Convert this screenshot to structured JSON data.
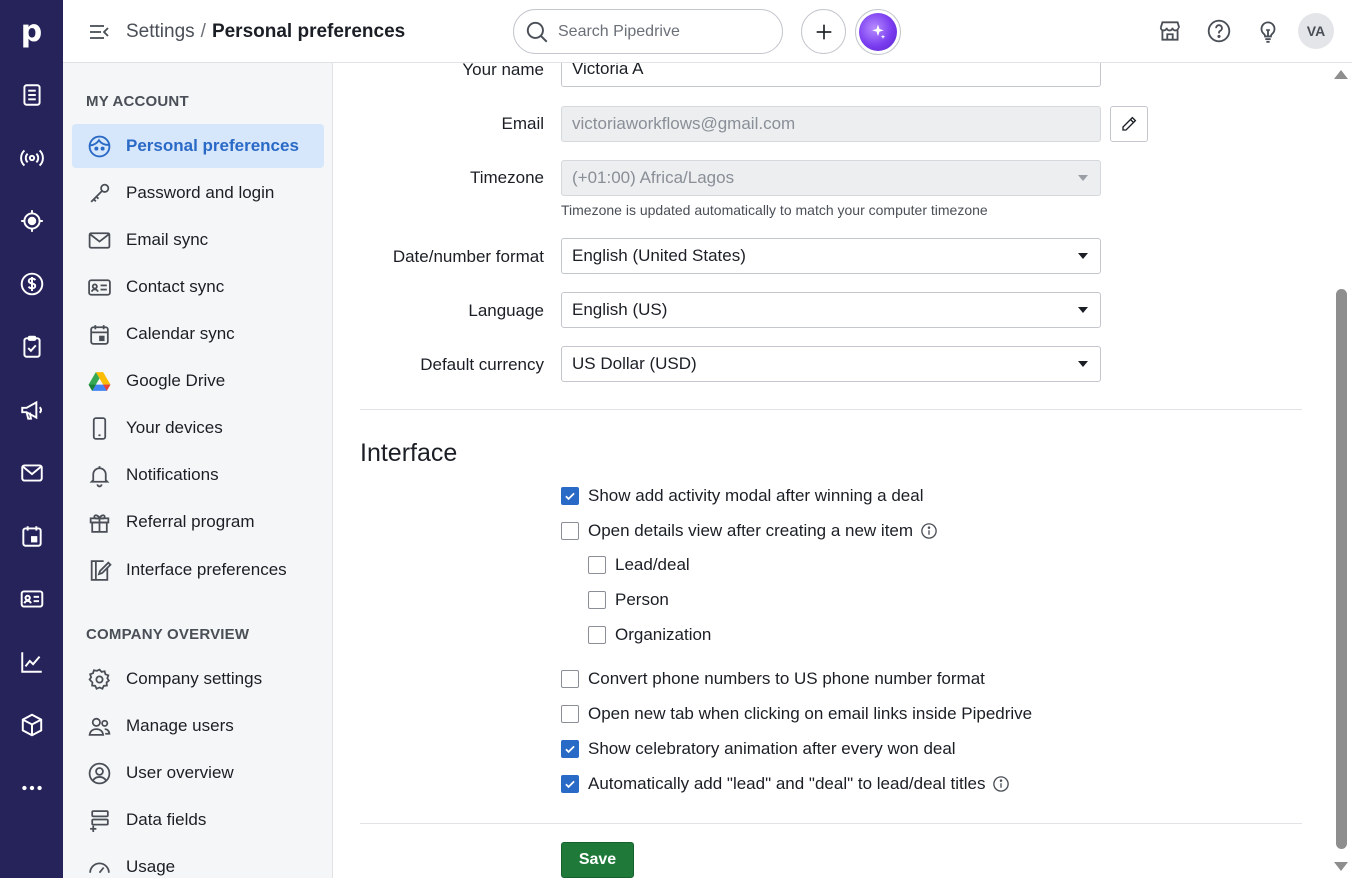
{
  "app": {
    "logo_letter": "p",
    "brand_color": "#26235a",
    "accent_color": "#2a6ac7",
    "save_color": "#1f7a3a"
  },
  "rail": {
    "icons": [
      "leads-icon",
      "broadcast-icon",
      "target-icon",
      "dollar-icon",
      "clipboard-check-icon",
      "megaphone-icon",
      "mail-icon",
      "calendar-icon",
      "contact-card-icon",
      "chart-icon",
      "box-icon",
      "more-icon"
    ]
  },
  "header": {
    "breadcrumb_root": "Settings",
    "breadcrumb_sep": "/",
    "breadcrumb_current": "Personal preferences",
    "search_placeholder": "Search Pipedrive",
    "avatar_initials": "VA"
  },
  "sidebar": {
    "my_account_title": "MY ACCOUNT",
    "my_account": [
      {
        "label": "Personal preferences",
        "icon": "face-icon",
        "active": true
      },
      {
        "label": "Password and login",
        "icon": "key-icon"
      },
      {
        "label": "Email sync",
        "icon": "envelope-icon"
      },
      {
        "label": "Contact sync",
        "icon": "contact-card-icon"
      },
      {
        "label": "Calendar sync",
        "icon": "calendar-icon"
      },
      {
        "label": "Google Drive",
        "icon": "google-drive-icon"
      },
      {
        "label": "Your devices",
        "icon": "phone-icon"
      },
      {
        "label": "Notifications",
        "icon": "bell-icon"
      },
      {
        "label": "Referral program",
        "icon": "gift-icon"
      },
      {
        "label": "Interface preferences",
        "icon": "interface-edit-icon"
      }
    ],
    "company_title": "COMPANY OVERVIEW",
    "company": [
      {
        "label": "Company settings",
        "icon": "gear-icon"
      },
      {
        "label": "Manage users",
        "icon": "users-icon"
      },
      {
        "label": "User overview",
        "icon": "user-circle-icon"
      },
      {
        "label": "Data fields",
        "icon": "data-fields-icon"
      },
      {
        "label": "Usage",
        "icon": "gauge-icon"
      }
    ]
  },
  "form": {
    "name_label": "Your name",
    "name_value": "Victoria A",
    "email_label": "Email",
    "email_value": "victoriaworkflows@gmail.com",
    "timezone_label": "Timezone",
    "timezone_value": "(+01:00) Africa/Lagos",
    "timezone_hint": "Timezone is updated automatically to match your computer timezone",
    "date_label": "Date/number format",
    "date_value": "English (United States)",
    "language_label": "Language",
    "language_value": "English (US)",
    "currency_label": "Default currency",
    "currency_value": "US Dollar (USD)"
  },
  "interface": {
    "title": "Interface",
    "options": [
      {
        "label": "Show add activity modal after winning a deal",
        "checked": true
      },
      {
        "label": "Open details view after creating a new item",
        "checked": false,
        "info": true
      },
      {
        "label": "Lead/deal",
        "checked": false,
        "indent": true
      },
      {
        "label": "Person",
        "checked": false,
        "indent": true
      },
      {
        "label": "Organization",
        "checked": false,
        "indent": true
      },
      {
        "label": "Convert phone numbers to US phone number format",
        "checked": false
      },
      {
        "label": "Open new tab when clicking on email links inside Pipedrive",
        "checked": false
      },
      {
        "label": "Show celebratory animation after every won deal",
        "checked": true
      },
      {
        "label": "Automatically add \"lead\" and \"deal\" to lead/deal titles",
        "checked": true,
        "info": true
      }
    ],
    "save_label": "Save"
  }
}
